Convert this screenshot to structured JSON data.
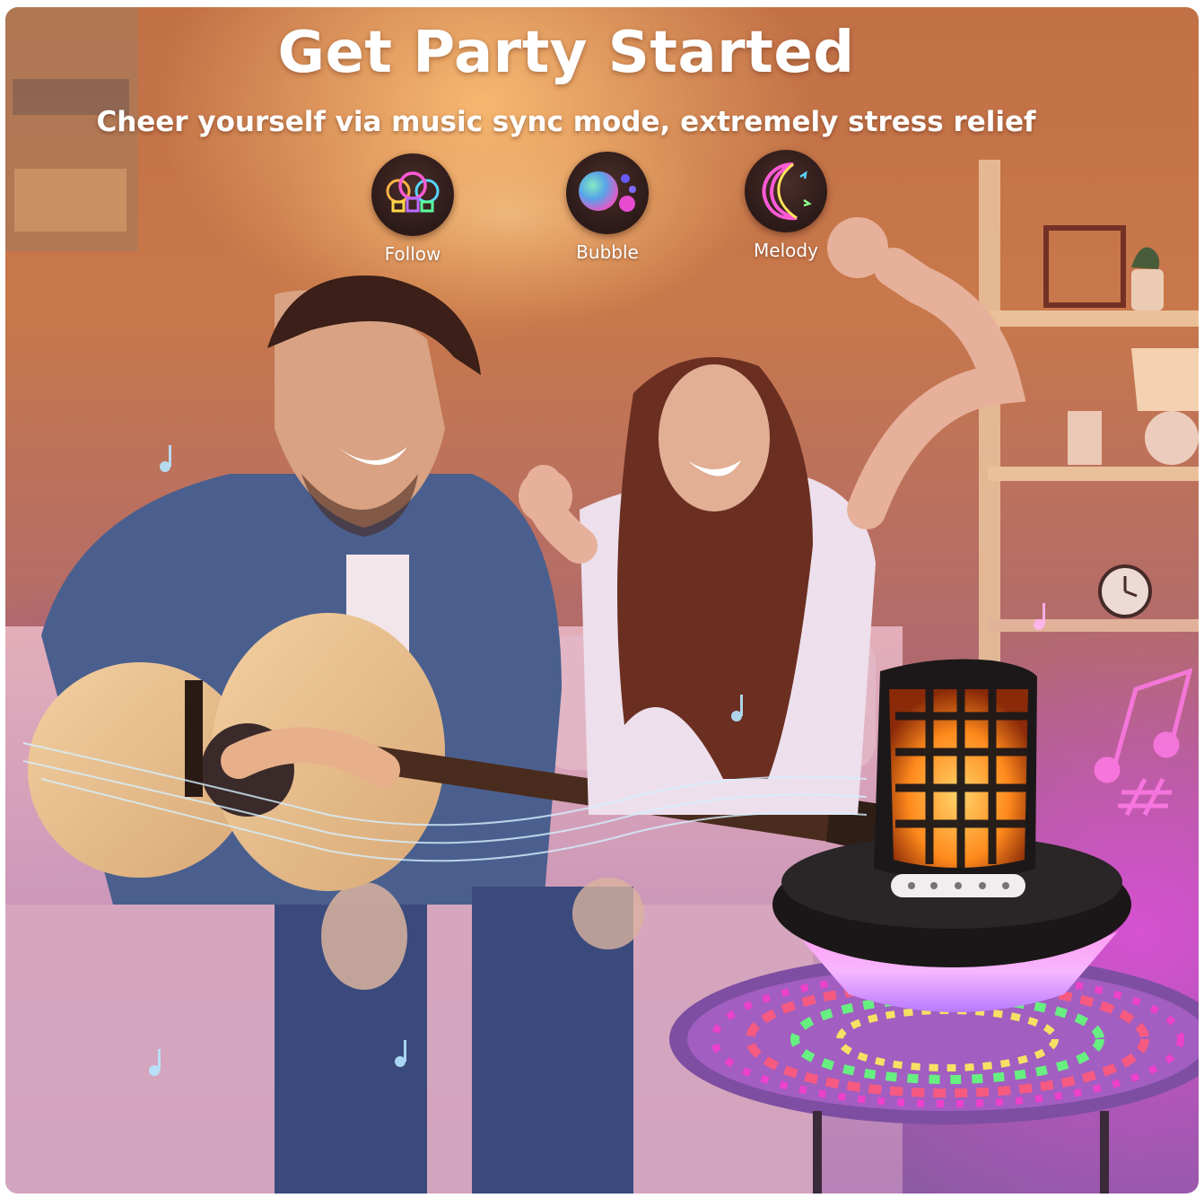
{
  "banner": {
    "title": "Get Party Started",
    "subtitle": "Cheer yourself via music sync mode, extremely stress relief"
  },
  "modes": [
    {
      "label": "Follow",
      "icon": "light-bulbs-icon"
    },
    {
      "label": "Bubble",
      "icon": "bubbles-icon"
    },
    {
      "label": "Melody",
      "icon": "crescent-moon-icon"
    }
  ],
  "colors": {
    "text": "#ffffff",
    "icon_circle": "#2c1a19",
    "warm_glow": "#ffc478",
    "magenta_glow": "#e250dc"
  }
}
